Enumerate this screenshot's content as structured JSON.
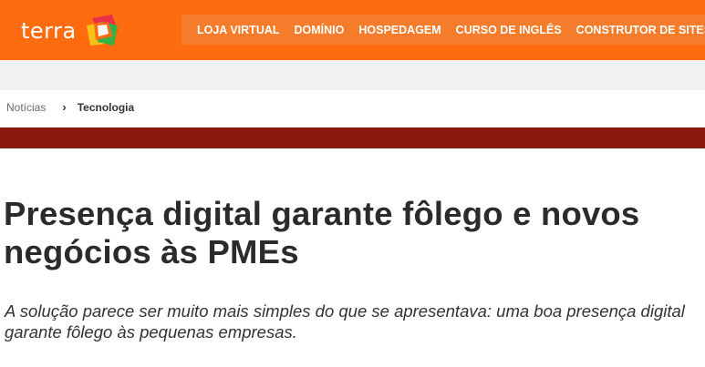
{
  "header": {
    "logo_text": "terra",
    "nav": [
      {
        "label": "LOJA VIRTUAL"
      },
      {
        "label": "DOMÍNIO"
      },
      {
        "label": "HOSPEDAGEM"
      },
      {
        "label": "CURSO DE INGLÊS"
      },
      {
        "label": "CONSTRUTOR DE SITES"
      }
    ],
    "colors": {
      "bar": "#ff6b0f",
      "nav_bg": "#f57c2b"
    }
  },
  "breadcrumb": {
    "items": [
      {
        "label": "Notícias"
      },
      {
        "label": "Tecnologia"
      }
    ],
    "separator": "›"
  },
  "article": {
    "title": "Presença digital garante fôlego e novos negócios às PMEs",
    "subtitle": "A solução parece ser muito mais simples do que se apresentava: uma boa presença digital garante fôlego às pequenas empresas."
  },
  "colors": {
    "section_band": "#8b1a0e",
    "gray_strip": "#f2f2f2"
  }
}
